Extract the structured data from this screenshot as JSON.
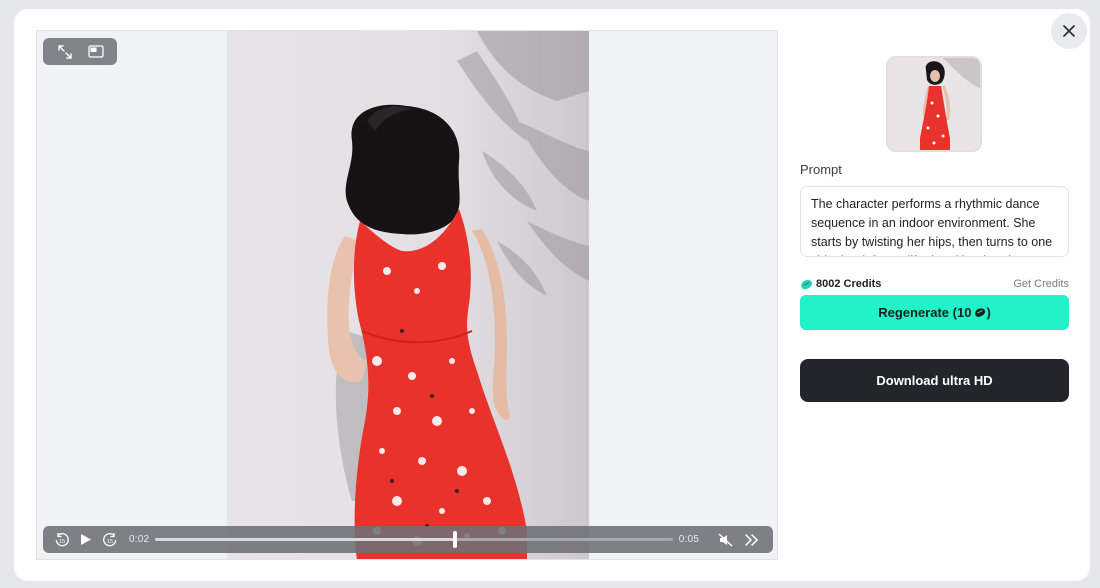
{
  "video": {
    "current_time": "0:02",
    "duration": "0:05",
    "progress": 0.58
  },
  "panel": {
    "prompt_label": "Prompt",
    "prompt_text": "The character performs a rhythmic dance sequence in an indoor environment. She starts by twisting her hips, then turns to one side, her left arm lifted and her hand lowering",
    "credits": "8002 Credits",
    "get_credits_label": "Get Credits",
    "regenerate_label": "Regenerate (10",
    "regenerate_suffix": ")",
    "download_label": "Download ultra HD"
  },
  "colors": {
    "accent": "#22f2c8",
    "dark_button": "#23252a",
    "dress": "#e8322b"
  },
  "icons": {
    "close": "close-icon",
    "fullscreen": "expand-icon",
    "pip": "picture-in-picture-icon",
    "rewind": "rewind-15-icon",
    "play": "play-icon",
    "forward": "forward-15-icon",
    "mute": "mute-icon",
    "next": "double-chevron-right-icon",
    "credit": "credit-drop-icon"
  }
}
